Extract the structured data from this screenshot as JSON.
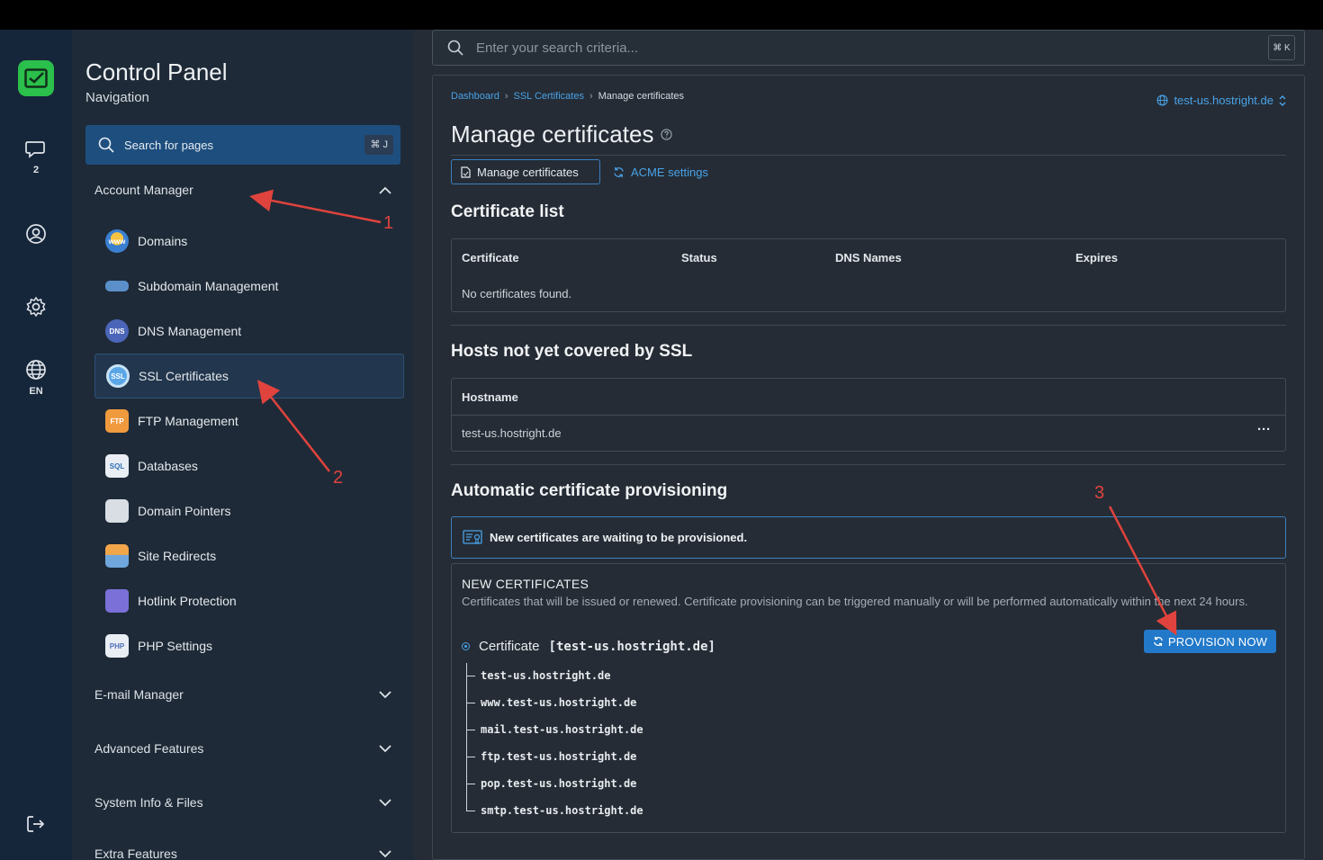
{
  "rail": {
    "chat_count": "2",
    "language": "EN"
  },
  "sidebar": {
    "title": "Control Panel",
    "subtitle": "Navigation",
    "search_label": "Search for pages",
    "search_shortcut": "⌘ J",
    "sections": {
      "account_manager": "Account Manager",
      "email_manager": "E-mail Manager",
      "advanced_features": "Advanced Features",
      "system_info": "System Info & Files",
      "extra_features": "Extra Features"
    },
    "items": [
      {
        "label": "Domains",
        "icon": "domains-icon"
      },
      {
        "label": "Subdomain Management",
        "icon": "subdomain-icon"
      },
      {
        "label": "DNS Management",
        "icon": "dns-icon"
      },
      {
        "label": "SSL Certificates",
        "icon": "ssl-icon",
        "active": true
      },
      {
        "label": "FTP Management",
        "icon": "ftp-icon"
      },
      {
        "label": "Databases",
        "icon": "database-icon"
      },
      {
        "label": "Domain Pointers",
        "icon": "domain-pointer-icon"
      },
      {
        "label": "Site Redirects",
        "icon": "redirect-icon"
      },
      {
        "label": "Hotlink Protection",
        "icon": "lock-icon"
      },
      {
        "label": "PHP Settings",
        "icon": "php-icon"
      }
    ]
  },
  "search": {
    "placeholder": "Enter your search criteria...",
    "shortcut": "⌘ K"
  },
  "breadcrumb": [
    "Dashboard",
    "SSL Certificates",
    "Manage certificates"
  ],
  "domain_selector": "test-us.hostright.de",
  "page_title": "Manage certificates",
  "tabs": [
    "Manage certificates",
    "ACME settings"
  ],
  "certificate_list": {
    "heading": "Certificate list",
    "columns": [
      "Certificate",
      "Status",
      "DNS Names",
      "Expires"
    ],
    "empty": "No certificates found."
  },
  "hosts": {
    "heading": "Hosts not yet covered by SSL",
    "column": "Hostname",
    "rows": [
      "test-us.hostright.de"
    ],
    "more": "···"
  },
  "provisioning": {
    "heading": "Automatic certificate provisioning",
    "alert": "New certificates are waiting to be provisioned.",
    "new_heading": "NEW CERTIFICATES",
    "description": "Certificates that will be issued or renewed. Certificate provisioning can be triggered manually or will be performed automatically within the next 24 hours.",
    "cert_prefix": "Certificate",
    "cert_name": "[test-us.hostright.de]",
    "button": "PROVISION NOW",
    "hosts": [
      "test-us.hostright.de",
      "www.test-us.hostright.de",
      "mail.test-us.hostright.de",
      "ftp.test-us.hostright.de",
      "pop.test-us.hostright.de",
      "smtp.test-us.hostright.de"
    ]
  },
  "annotations": [
    "1",
    "2",
    "3"
  ],
  "colors": {
    "accent": "#4aa3e8",
    "primary_button": "#2279c9",
    "annotation": "#e0433d",
    "logo": "#2bbf4b"
  }
}
